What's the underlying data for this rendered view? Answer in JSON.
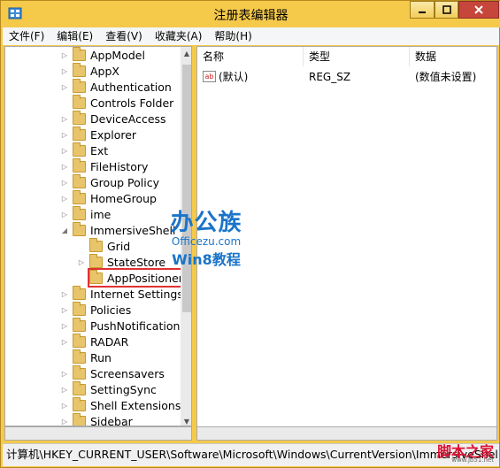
{
  "window": {
    "title": "注册表编辑器",
    "accent": "#f5c94a"
  },
  "menu": [
    "文件(F)",
    "编辑(E)",
    "查看(V)",
    "收藏夹(A)",
    "帮助(H)"
  ],
  "tree": [
    {
      "label": "AppModel",
      "expander": "▷",
      "indent": 0
    },
    {
      "label": "AppX",
      "expander": "▷",
      "indent": 0
    },
    {
      "label": "Authentication",
      "expander": "▷",
      "indent": 0
    },
    {
      "label": "Controls Folder",
      "expander": "",
      "indent": 0
    },
    {
      "label": "DeviceAccess",
      "expander": "▷",
      "indent": 0
    },
    {
      "label": "Explorer",
      "expander": "▷",
      "indent": 0
    },
    {
      "label": "Ext",
      "expander": "▷",
      "indent": 0
    },
    {
      "label": "FileHistory",
      "expander": "▷",
      "indent": 0
    },
    {
      "label": "Group Policy",
      "expander": "▷",
      "indent": 0
    },
    {
      "label": "HomeGroup",
      "expander": "▷",
      "indent": 0
    },
    {
      "label": "ime",
      "expander": "▷",
      "indent": 0
    },
    {
      "label": "ImmersiveShell",
      "expander": "◢",
      "indent": 0
    },
    {
      "label": "Grid",
      "expander": "",
      "indent": 1
    },
    {
      "label": "StateStore",
      "expander": "▷",
      "indent": 1
    },
    {
      "label": "AppPositioner",
      "expander": "",
      "indent": 1
    },
    {
      "label": "Internet Settings",
      "expander": "▷",
      "indent": 0
    },
    {
      "label": "Policies",
      "expander": "▷",
      "indent": 0
    },
    {
      "label": "PushNotifications",
      "expander": "▷",
      "indent": 0
    },
    {
      "label": "RADAR",
      "expander": "▷",
      "indent": 0
    },
    {
      "label": "Run",
      "expander": "",
      "indent": 0
    },
    {
      "label": "Screensavers",
      "expander": "▷",
      "indent": 0
    },
    {
      "label": "SettingSync",
      "expander": "▷",
      "indent": 0
    },
    {
      "label": "Shell Extensions",
      "expander": "▷",
      "indent": 0
    },
    {
      "label": "Sidebar",
      "expander": "▷",
      "indent": 0
    }
  ],
  "values": {
    "headers": {
      "name": "名称",
      "type": "类型",
      "data": "数据"
    },
    "rows": [
      {
        "icon": "ab",
        "name": "(默认)",
        "type": "REG_SZ",
        "data": "(数值未设置)"
      }
    ]
  },
  "watermark": {
    "main": "办公族",
    "site": "Officezu.com",
    "sub": "Win8教程"
  },
  "status": "计算机\\HKEY_CURRENT_USER\\Software\\Microsoft\\Windows\\CurrentVersion\\ImmersiveShell",
  "corner": {
    "logo": "脚本之家",
    "url": "www.jb51.net"
  }
}
